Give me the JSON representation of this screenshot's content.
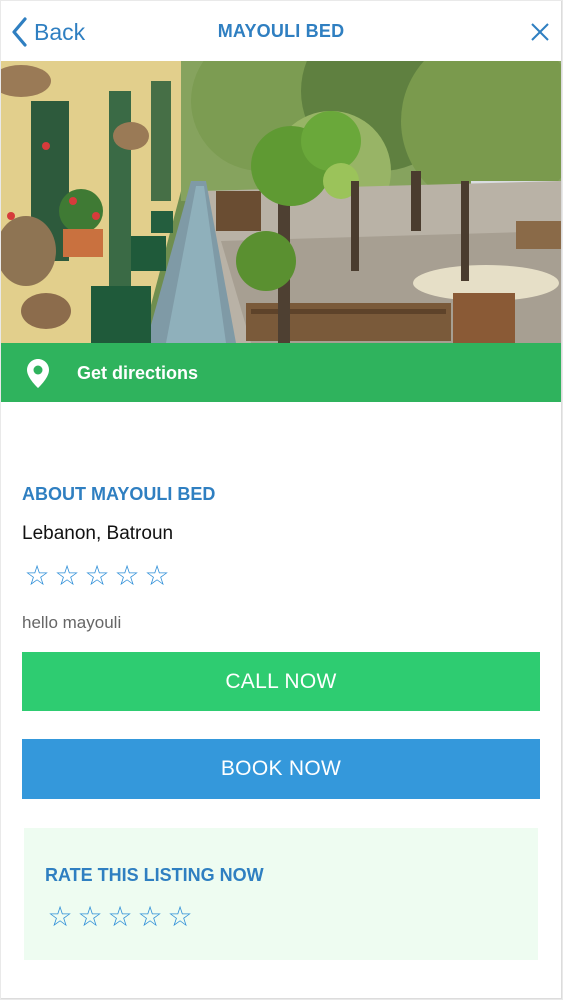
{
  "header": {
    "back_label": "Back",
    "title": "MAYOULI BED",
    "back_icon": "chevron-left-icon",
    "close_icon": "close-icon"
  },
  "hero": {
    "icon": "garden-photo"
  },
  "directions": {
    "label": "Get directions",
    "icon": "map-pin-icon"
  },
  "about": {
    "title": "ABOUT MAYOULI BED",
    "location": "Lebanon, Batroun",
    "rating_stars": [
      "☆",
      "☆",
      "☆",
      "☆",
      "☆"
    ],
    "description": "hello mayouli"
  },
  "actions": {
    "call_label": "CALL NOW",
    "book_label": "BOOK NOW"
  },
  "rate": {
    "title": "RATE THIS LISTING NOW",
    "stars": [
      "☆",
      "☆",
      "☆",
      "☆",
      "☆"
    ]
  },
  "colors": {
    "brand_blue": "#2f7fc1",
    "directions_green": "#2fb35d",
    "call_green": "#2ecc71",
    "book_blue": "#3498db",
    "rate_bg": "#eefcf1"
  }
}
